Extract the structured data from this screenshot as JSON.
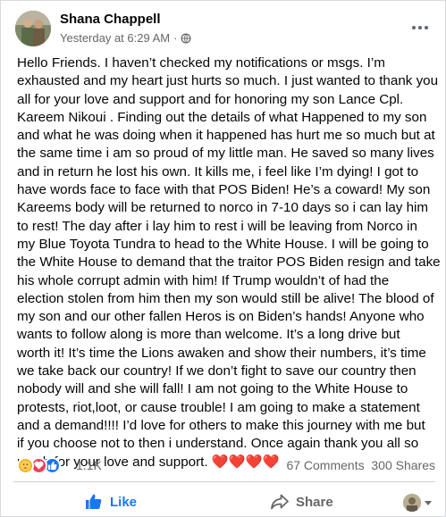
{
  "post": {
    "author": "Shana Chappell",
    "timestamp": "Yesterday at 6:29 AM",
    "separator": "·",
    "privacy_icon": "globe-icon",
    "menu_icon": "more-options-icon",
    "lines": [
      "Hello Friends. I haven’t checked my notifications or msgs. I’m",
      "exhausted and my heart just hurts so much. I just wanted to thank you",
      "all for your love and support and for honoring my son Lance Cpl.",
      "Kareem Nikoui . Finding out the details of what Happened to my son",
      "and what he was doing when it happened has  hurt me so much but at",
      "the same time i am so proud of my little man. He saved so many lives",
      "and in return he lost his own. It kills me, i feel like I’m dying! I got to",
      "have words face to face with that POS Biden! He’s a coward! My son",
      "Kareems body will be returned to norco in 7-10 days so i can lay him",
      "to rest! The day after i lay him to rest i will be leaving from Norco in",
      "my Blue Toyota Tundra to head to the White House. I will be going to",
      "the White House to demand that the traitor POS Biden resign and take",
      "his whole corrupt admin with him!  If Trump wouldn’t of had the",
      "election stolen from him then my son would still be alive! The blood of",
      "my son and our other fallen Heros is on Biden’s hands! Anyone who",
      "wants to follow along is more than welcome. It’s a long drive but",
      "worth it! It’s time the Lions awaken and show their numbers, it’s time",
      "we take back our country! If we don’t fight to save our country then",
      "nobody will and she will fall! I am not going to the White House to",
      "protests, riot,loot, or cause trouble! I am going to make a statement",
      "and a demand!!!! I’d love for others to make this journey with me but",
      "if you choose not to then i understand. Once again thank you all so",
      "much for your love and support."
    ],
    "hearts": "❤️❤️❤️❤️"
  },
  "stats": {
    "reaction_icons": [
      "care-reaction-icon",
      "love-reaction-icon",
      "like-reaction-icon"
    ],
    "reaction_count": "1.1K",
    "comments": "67 Comments",
    "shares": "300 Shares"
  },
  "actions": {
    "like_label": "Like",
    "share_label": "Share"
  },
  "colors": {
    "accent": "#1877f2",
    "secondary_text": "#65676b",
    "love": "#f33e58",
    "care": "#f7b125"
  }
}
